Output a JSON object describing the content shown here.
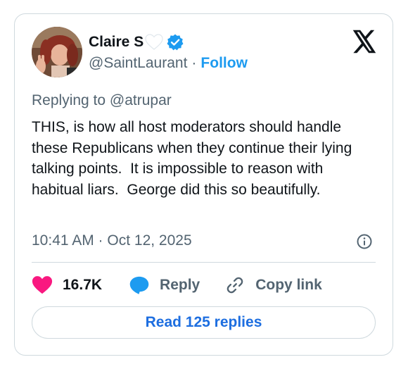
{
  "author": {
    "name": "Claire S",
    "handle": "@SaintLaurant",
    "separator": "·",
    "follow_label": "Follow",
    "verified": true
  },
  "reply_context": {
    "prefix": "Replying to ",
    "mention": "@atrupar"
  },
  "tweet": {
    "text": "THIS, is how all host moderators should handle these Republicans when they continue their lying talking points.  It is impossible to reason with habitual liars.  George did this so beautifully.",
    "timestamp": "10:41 AM · Oct 12, 2025"
  },
  "actions": {
    "like_count": "16.7K",
    "reply_label": "Reply",
    "copy_link_label": "Copy link"
  },
  "read_replies_label": "Read 125 replies",
  "colors": {
    "accent": "#1d9bf0",
    "like": "#f91880",
    "muted": "#536471",
    "border": "#cfd9de",
    "read_replies_text": "#1d6ee0"
  },
  "icons": [
    "white-heart-icon",
    "verified-badge-icon",
    "x-logo-icon",
    "info-icon",
    "heart-icon",
    "reply-bubble-icon",
    "link-icon"
  ]
}
